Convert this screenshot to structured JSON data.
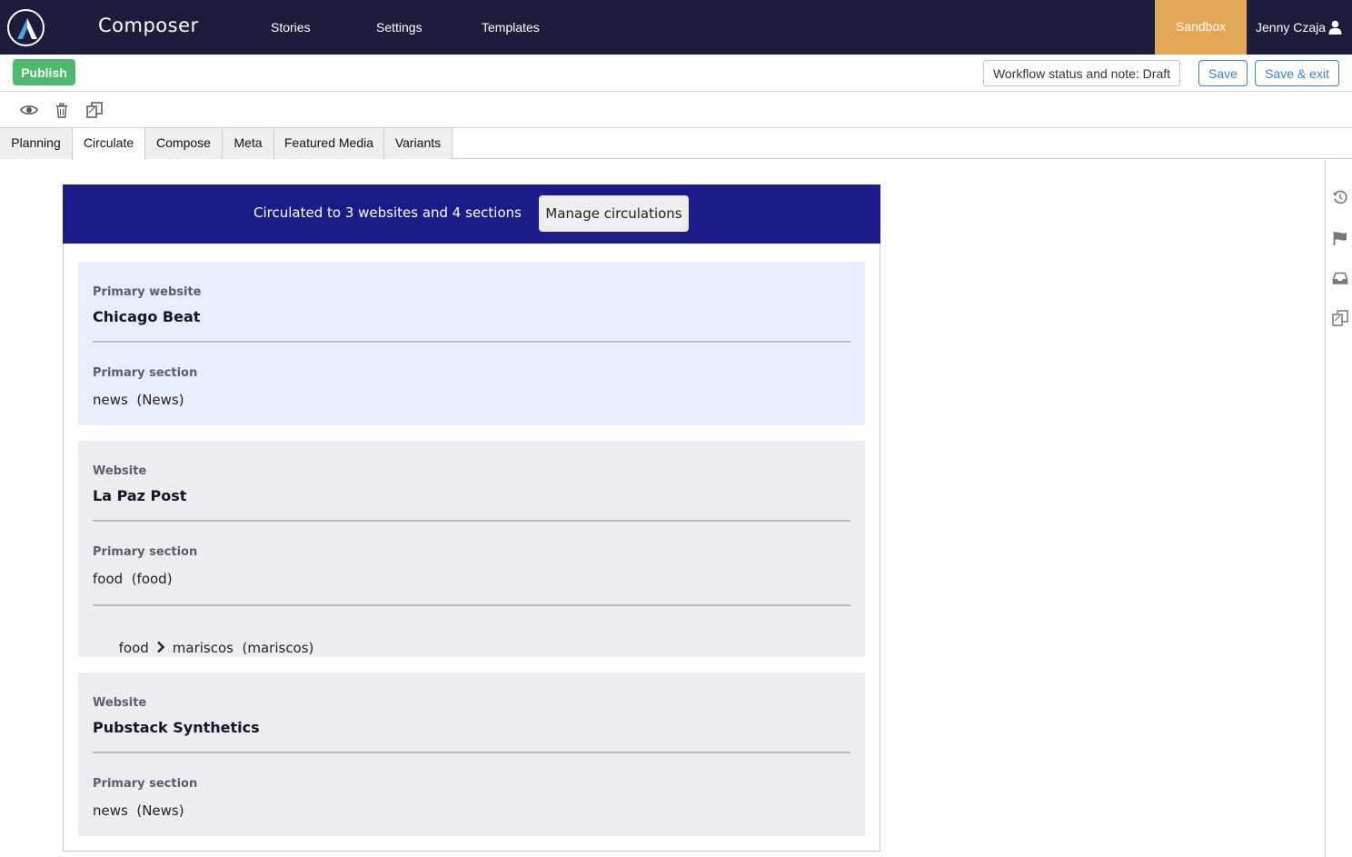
{
  "topnav": {
    "app_title": "Composer",
    "links": [
      "Stories",
      "Settings",
      "Templates"
    ],
    "environment": "Sandbox",
    "user_name": "Jenny Czaja"
  },
  "actionbar": {
    "publish_label": "Publish",
    "workflow_label": "Workflow status and note: Draft",
    "save_label": "Save",
    "save_exit_label": "Save & exit"
  },
  "toolbar_icons": [
    "eye-icon",
    "trash-icon",
    "copy-icon"
  ],
  "tabs": [
    "Planning",
    "Circulate",
    "Compose",
    "Meta",
    "Featured Media",
    "Variants"
  ],
  "active_tab": "Circulate",
  "rail_icons": [
    "history-icon",
    "flag-icon",
    "inbox-icon",
    "copy-icon"
  ],
  "circulation": {
    "summary": "Circulated to 3 websites and 4 sections",
    "manage_label": "Manage circulations",
    "cards": [
      {
        "site_label": "Primary website",
        "site_name": "Chicago Beat",
        "section_label": "Primary section",
        "primary_section": "news  (News)"
      },
      {
        "site_label": "Website",
        "site_name": "La Paz Post",
        "section_label": "Primary section",
        "primary_section": "food  (food)",
        "extra_section_parent": "food",
        "extra_section_child": "mariscos  (mariscos)"
      },
      {
        "site_label": "Website",
        "site_name": "Pubstack Synthetics",
        "section_label": "Primary section",
        "primary_section": "news  (News)"
      }
    ]
  },
  "colors": {
    "nav_bg": "#1c1c3c",
    "sandbox": "#e3a857",
    "publish": "#4fb96e",
    "accent_blue": "#3b82c4",
    "banner": "#1b1c8a",
    "primary_card": "#e8eefb",
    "card": "#ededf1"
  }
}
